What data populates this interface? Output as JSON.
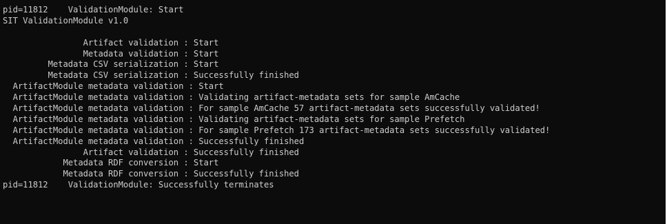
{
  "console": {
    "lines": [
      "pid=11812    ValidationModule: Start",
      "SIT ValidationModule v1.0",
      "",
      "                Artifact validation : Start",
      "                Metadata validation : Start",
      "         Metadata CSV serialization : Start",
      "         Metadata CSV serialization : Successfully finished",
      "  ArtifactModule metadata validation : Start",
      "  ArtifactModule metadata validation : Validating artifact-metadata sets for sample AmCache",
      "  ArtifactModule metadata validation : For sample AmCache 57 artifact-metadata sets successfully validated!",
      "  ArtifactModule metadata validation : Validating artifact-metadata sets for sample Prefetch",
      "  ArtifactModule metadata validation : For sample Prefetch 173 artifact-metadata sets successfully validated!",
      "  ArtifactModule metadata validation : Successfully finished",
      "                Artifact validation : Successfully finished",
      "            Metadata RDF conversion : Start",
      "            Metadata RDF conversion : Successfully finished",
      "pid=11812    ValidationModule: Successfully terminates"
    ]
  },
  "colors": {
    "background": "#0c0c0c",
    "text": "#cccccc"
  }
}
